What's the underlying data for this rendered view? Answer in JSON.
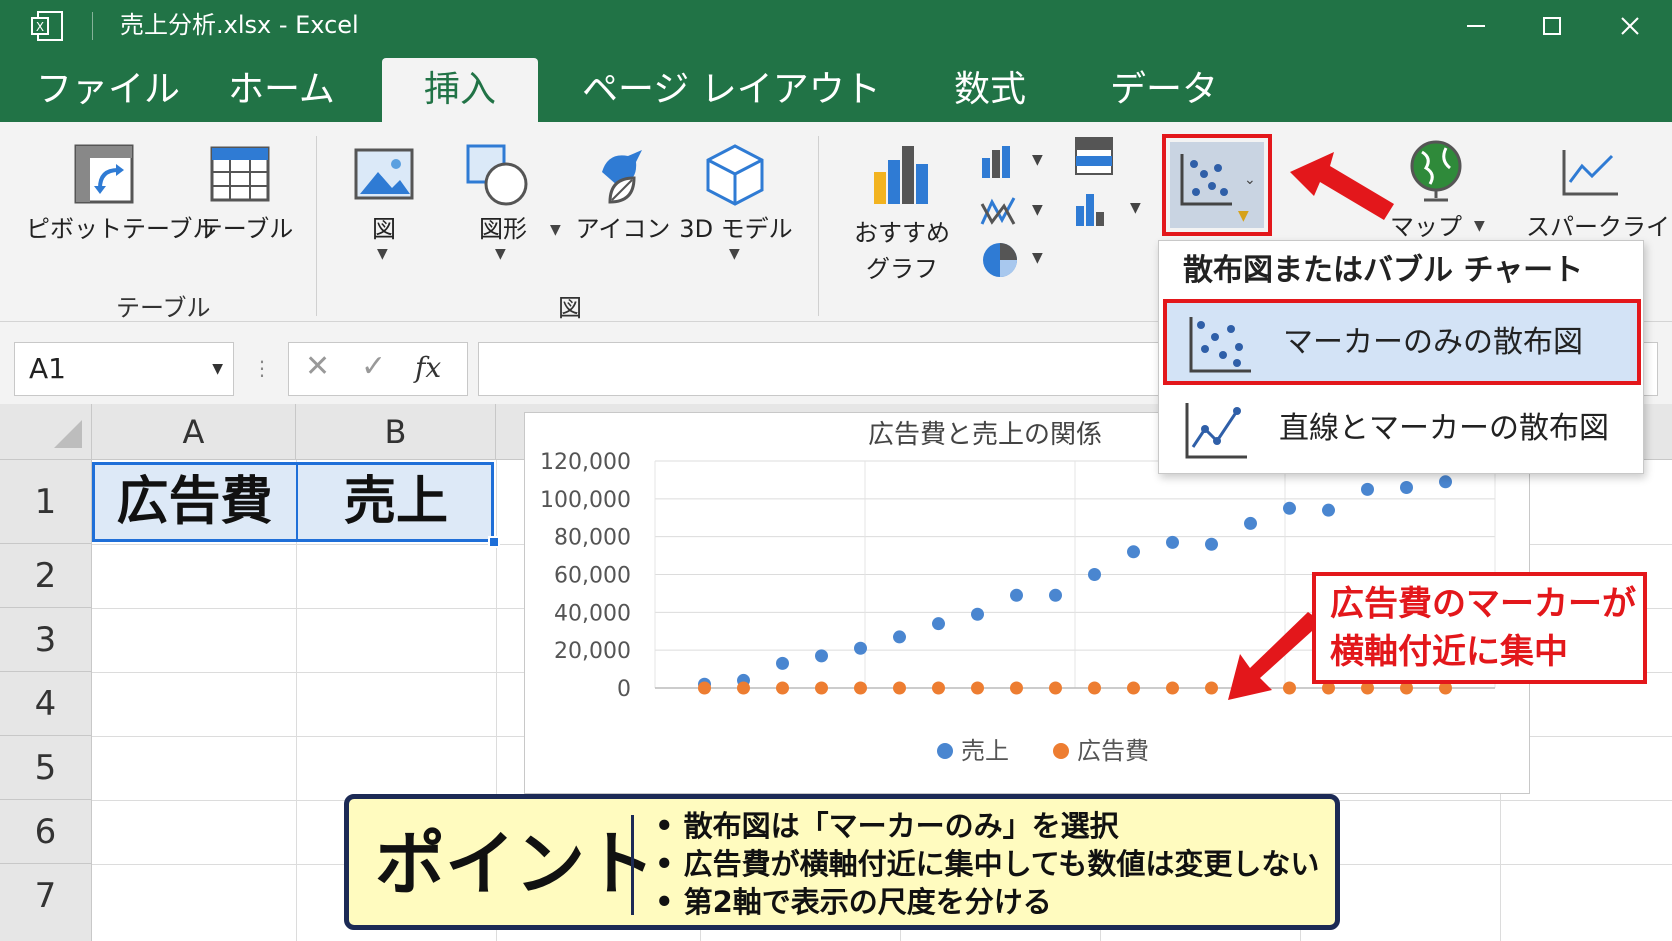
{
  "window": {
    "title": "売上分析.xlsx  -  Excel",
    "app_icon": "excel-icon"
  },
  "tabs": [
    {
      "label": "ファイル",
      "active": false
    },
    {
      "label": "ホーム",
      "active": false
    },
    {
      "label": "挿入",
      "active": true
    },
    {
      "label": "ページ レイアウト",
      "active": false
    },
    {
      "label": "数式",
      "active": false
    },
    {
      "label": "データ",
      "active": false
    }
  ],
  "ribbon": {
    "groups": {
      "table": "テーブル",
      "illustrations": "図"
    },
    "buttons": {
      "pivot": "ピボットテーブル",
      "table": "テーブル",
      "pictures": "図",
      "shapes": "図形",
      "icons": "アイコン",
      "models3d": "3D モデル",
      "recommended_line1": "おすすめ",
      "recommended_line2": "グラフ",
      "maps": "マップ",
      "sparklines": "スパークライン"
    }
  },
  "formula_bar": {
    "name_box": "A1",
    "fx": "fx",
    "value": ""
  },
  "sheet": {
    "columns": [
      "A",
      "B"
    ],
    "rows": [
      "1",
      "2",
      "3",
      "4",
      "5",
      "6",
      "7"
    ],
    "cells": {
      "A1": "広告費",
      "B1": "売上"
    }
  },
  "dropdown": {
    "title": "散布図またはバブル チャート",
    "items": [
      {
        "label": "マーカーのみの散布図",
        "highlighted": true
      },
      {
        "label": "直線とマーカーの散布図",
        "highlighted": false
      }
    ]
  },
  "annotation": {
    "line1": "広告費のマーカーが",
    "line2": "横軸付近に集中"
  },
  "point_box": {
    "title": "ポイント",
    "items": [
      "• 散布図は「マーカーのみ」を選択",
      "• 広告費が横軸付近に集中しても数値は変更しない",
      "• 第2軸で表示の尺度を分ける"
    ]
  },
  "colors": {
    "excel_green": "#217346",
    "series_sales": "#4a86d0",
    "series_ad": "#ed7d31",
    "highlight_red": "#e3171b",
    "point_bg": "#fffbbf"
  },
  "chart_data": {
    "type": "scatter",
    "title": "広告費と売上の関係",
    "xlabel": "",
    "ylabel": "",
    "ylim": [
      0,
      120000
    ],
    "yticks": [
      "120,000",
      "100,000",
      "80,000",
      "60,000",
      "40,000",
      "20,000",
      "0"
    ],
    "legend_position": "bottom",
    "grid": true,
    "series": [
      {
        "name": "売上",
        "color": "#4a86d0",
        "x": [
          1,
          2,
          3,
          4,
          5,
          6,
          7,
          8,
          9,
          10,
          11,
          12,
          13,
          14,
          15,
          16,
          17,
          18,
          19,
          20
        ],
        "y": [
          2000,
          4000,
          13000,
          17000,
          21000,
          27000,
          34000,
          39000,
          49000,
          49000,
          60000,
          72000,
          77000,
          76000,
          87000,
          95000,
          94000,
          105000,
          106000,
          109000
        ]
      },
      {
        "name": "広告費",
        "color": "#ed7d31",
        "x": [
          1,
          2,
          3,
          4,
          5,
          6,
          7,
          8,
          9,
          10,
          11,
          12,
          13,
          14,
          15,
          16,
          17,
          18,
          19,
          20
        ],
        "y": [
          0,
          0,
          0,
          0,
          0,
          0,
          0,
          0,
          0,
          0,
          0,
          0,
          0,
          0,
          0,
          0,
          0,
          0,
          0,
          0
        ]
      }
    ]
  }
}
